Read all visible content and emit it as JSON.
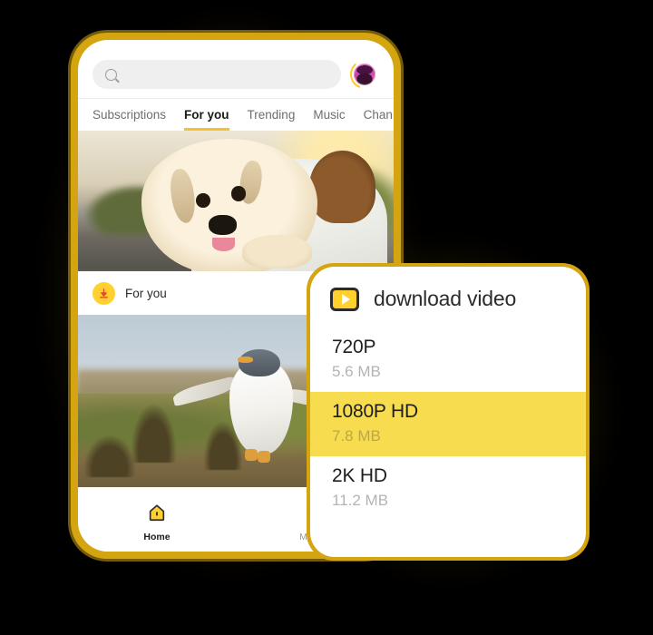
{
  "app": {
    "device_frame_color": "#D4A510",
    "accent_color": "#FFD02E",
    "highlight_color": "#F7DC50"
  },
  "search": {
    "icon": "search-icon",
    "value": "",
    "placeholder": ""
  },
  "avatar": {
    "icon": "avatar",
    "ring_color": "#FFC922"
  },
  "tabs": [
    {
      "label": "Subscriptions",
      "active": false
    },
    {
      "label": "For you",
      "active": true
    },
    {
      "label": "Trending",
      "active": false
    },
    {
      "label": "Music",
      "active": false
    },
    {
      "label": "Chan",
      "active": false
    }
  ],
  "feed": [
    {
      "name": "video-thumbnail-dog",
      "description": "Golden retriever puppy held over a person's shoulder at sunset"
    },
    {
      "name": "video-thumbnail-penguins",
      "description": "Gentoo penguins walking on grassy terrain"
    }
  ],
  "foryou_row": {
    "badge_icon": "download-arrow-icon",
    "label": "For you",
    "download_icon": "download-icon"
  },
  "bottom_nav": [
    {
      "label": "Home",
      "icon": "home-icon",
      "active": true
    },
    {
      "label": "My File",
      "icon": "download-circle-icon",
      "active": false
    }
  ],
  "download_panel": {
    "icon": "video-play-icon",
    "title": "download video",
    "options": [
      {
        "quality": "720P",
        "size": "5.6 MB",
        "selected": false
      },
      {
        "quality": "1080P HD",
        "size": "7.8 MB",
        "selected": true
      },
      {
        "quality": "2K HD",
        "size": "11.2 MB",
        "selected": false
      }
    ]
  }
}
